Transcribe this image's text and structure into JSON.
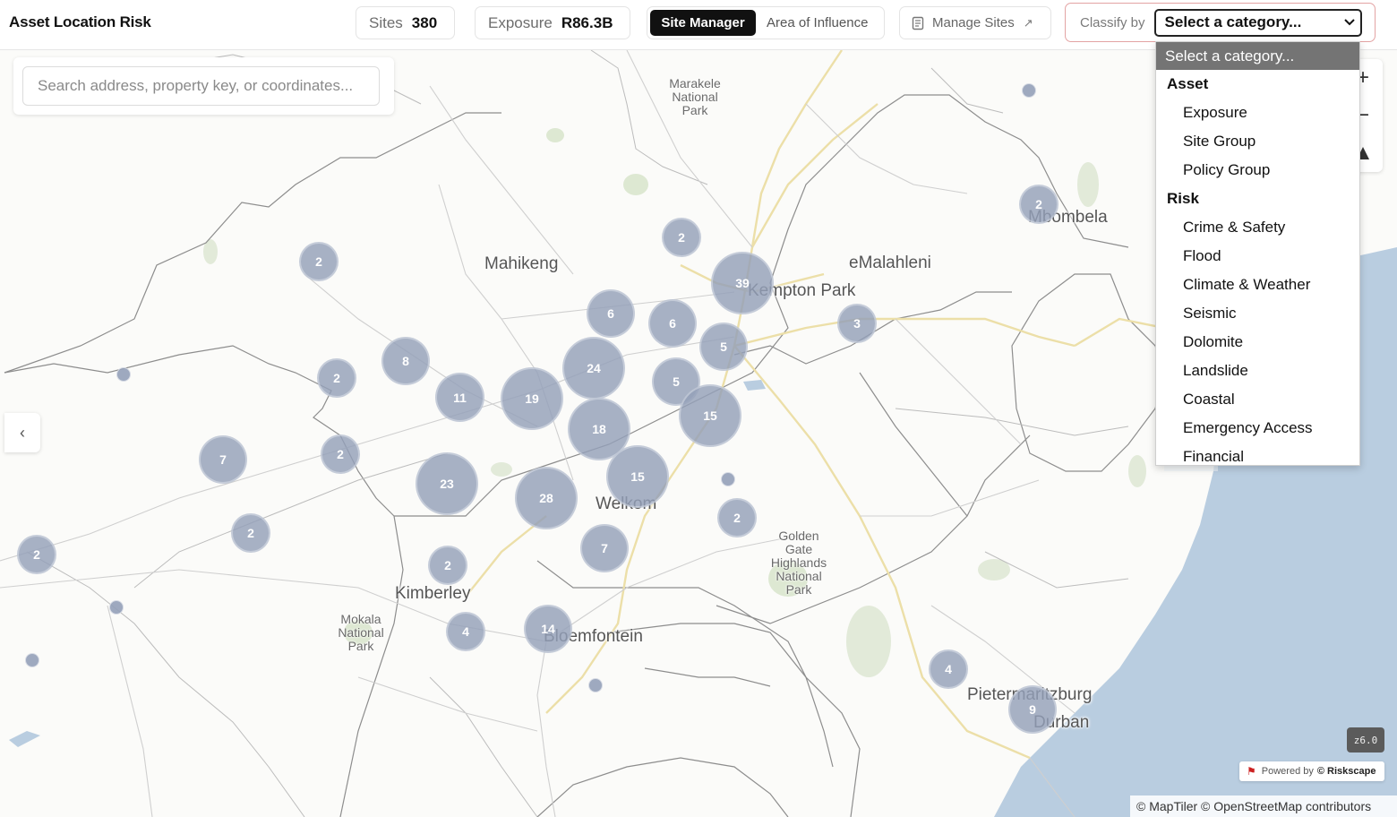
{
  "header": {
    "title": "Asset Location Risk",
    "sites_label": "Sites",
    "sites_value": "380",
    "exposure_label": "Exposure",
    "exposure_value": "R86.3B",
    "tabs": [
      {
        "label": "Site Manager",
        "active": true
      },
      {
        "label": "Area of Influence",
        "active": false
      }
    ],
    "manage_sites_label": "Manage Sites",
    "classify_label": "Classify by",
    "classify_selected": "Select a category..."
  },
  "search": {
    "placeholder": "Search address, property key, or coordinates..."
  },
  "dropdown": {
    "selected": "Select a category...",
    "groups": [
      {
        "label": "Asset",
        "items": [
          "Exposure",
          "Site Group",
          "Policy Group"
        ]
      },
      {
        "label": "Risk",
        "items": [
          "Crime & Safety",
          "Flood",
          "Climate & Weather",
          "Seismic",
          "Dolomite",
          "Landslide",
          "Coastal",
          "Emergency Access",
          "Financial"
        ]
      }
    ]
  },
  "map": {
    "cities": [
      "Mahikeng",
      "Kempton Park",
      "eMalahleni",
      "Mbombela",
      "Welkom",
      "Kimberley",
      "Bloemfontein",
      "Pietermaritzburg",
      "Durban"
    ],
    "parks": [
      "Marakele National Park",
      "Golden Gate Highlands National Park",
      "Mokala National Park"
    ],
    "clusters": [
      "2",
      "2",
      "39",
      "6",
      "6",
      "5",
      "3",
      "8",
      "2",
      "11",
      "19",
      "24",
      "5",
      "15",
      "18",
      "7",
      "2",
      "23",
      "28",
      "15",
      "2",
      "2",
      "2",
      "7",
      "2",
      "4",
      "14",
      "4",
      "9",
      "2"
    ],
    "zoom_level": "z6.0",
    "powered_by_prefix": "Powered by",
    "powered_by_brand": "© Riskscape",
    "attribution": "© MapTiler © OpenStreetMap contributors",
    "colors": {
      "cluster": "#94a0b8",
      "ocean": "#b9cde0",
      "roads": "#e9dca4"
    }
  }
}
